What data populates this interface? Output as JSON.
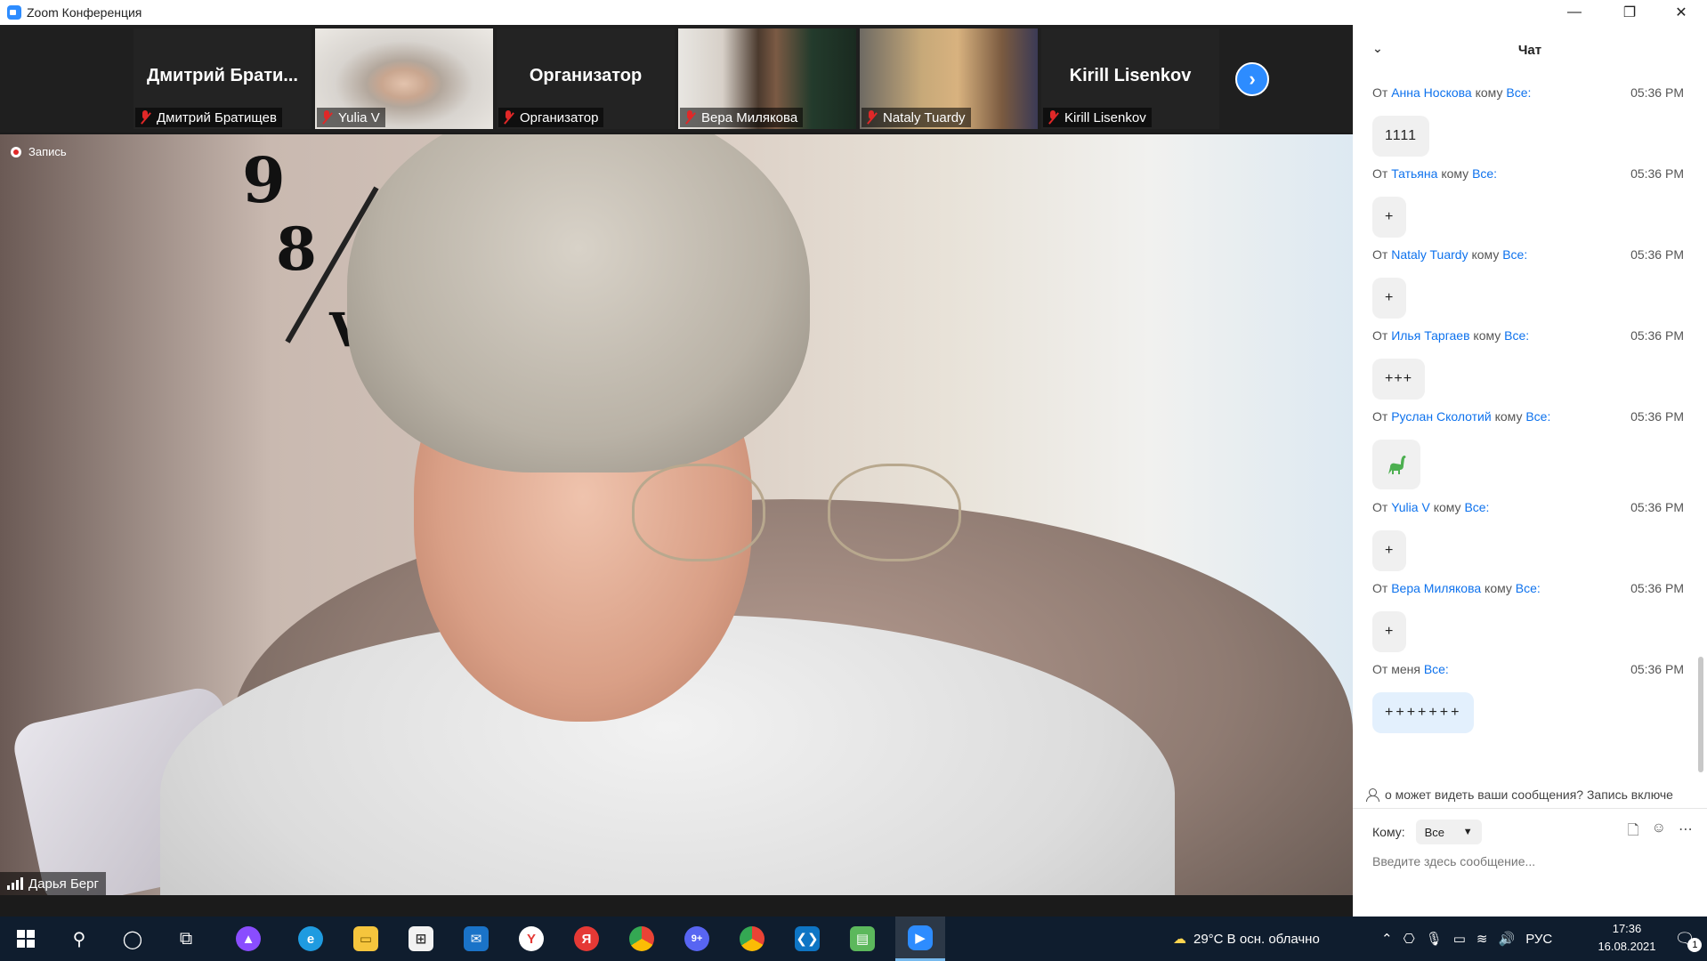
{
  "window": {
    "title": "Zoom Конференция",
    "controls": {
      "minimize": "—",
      "restore": "❐",
      "close": "✕"
    }
  },
  "thumbnails": [
    {
      "big_name": "Дмитрий Брати...",
      "caption": "Дмитрий Братищев",
      "has_video": false
    },
    {
      "big_name": "",
      "caption": "Yulia V",
      "has_video": true
    },
    {
      "big_name": "Организатор",
      "caption": "Организатор",
      "has_video": false
    },
    {
      "big_name": "",
      "caption": "Вера Милякова",
      "has_video": true
    },
    {
      "big_name": "",
      "caption": "Nataly Tuardy",
      "has_video": true
    },
    {
      "big_name": "Kirill Lisenkov",
      "caption": "Kirill Lisenkov",
      "has_video": false
    }
  ],
  "main_video": {
    "recording_label": "Запись",
    "speaker_name": "Дарья Берг"
  },
  "chat": {
    "title": "Чат",
    "from_word": "От",
    "to_word": "кому",
    "messages": [
      {
        "from": "Анна Носкова",
        "to": "Все:",
        "time": "05:36 PM",
        "text": "1111"
      },
      {
        "from": "Татьяна",
        "to": "Все:",
        "time": "05:36 PM",
        "text": "+"
      },
      {
        "from": "Nataly Tuardy",
        "to": "Все:",
        "time": "05:36 PM",
        "text": "+"
      },
      {
        "from": "Илья Таргаев",
        "to": "Все:",
        "time": "05:36 PM",
        "text": "+++"
      },
      {
        "from": "Руслан Сколотий",
        "to": "Все:",
        "time": "05:36 PM",
        "text": "",
        "emoji": "dinosaur-icon"
      },
      {
        "from": "Yulia V",
        "to": "Все:",
        "time": "05:36 PM",
        "text": "+"
      },
      {
        "from": "Вера Милякова",
        "to": "Все:",
        "time": "05:36 PM",
        "text": "+"
      }
    ],
    "own_message": {
      "from_label": "От меня",
      "to": "Все:",
      "time": "05:36 PM",
      "text": "+++++++"
    },
    "notice": "о может видеть ваши сообщения? Запись включе",
    "to_label": "Кому:",
    "to_value": "Все",
    "input_placeholder": "Введите здесь сообщение..."
  },
  "taskbar": {
    "weather": "29°C  В осн. облачно",
    "language": "РУС",
    "time": "17:36",
    "date": "16.08.2021",
    "notification_count": "1",
    "discord_badge": "9+",
    "accent": "#76b9ed"
  },
  "colors": {
    "zoom_blue": "#2d8cff",
    "link_blue": "#0e72ed",
    "mute_red": "#e02828"
  }
}
